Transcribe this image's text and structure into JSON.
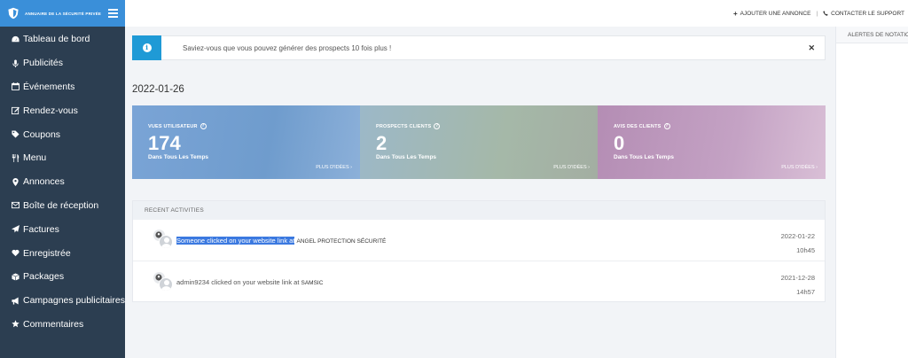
{
  "brand": {
    "name": "ANNUAIRE DE LA SÉCURITÉ PRIVÉE"
  },
  "sidebar": {
    "items": [
      {
        "label": "Tableau de bord",
        "icon": "dashboard-icon"
      },
      {
        "label": "Publicités",
        "icon": "microphone-icon"
      },
      {
        "label": "Événements",
        "icon": "calendar-icon"
      },
      {
        "label": "Rendez-vous",
        "icon": "edit-icon"
      },
      {
        "label": "Coupons",
        "icon": "tag-icon"
      },
      {
        "label": "Menu",
        "icon": "utensils-icon"
      },
      {
        "label": "Annonces",
        "icon": "map-marker-icon"
      },
      {
        "label": "Boîte de réception",
        "icon": "envelope-icon"
      },
      {
        "label": "Factures",
        "icon": "paper-plane-icon"
      },
      {
        "label": "Enregistrée",
        "icon": "heart-icon"
      },
      {
        "label": "Packages",
        "icon": "cube-icon"
      },
      {
        "label": "Campagnes publicitaires",
        "icon": "bullhorn-icon"
      },
      {
        "label": "Commentaires",
        "icon": "star-icon"
      }
    ]
  },
  "topbar": {
    "add_listing": "AJOUTER UNE ANNONCE",
    "contact_support": "CONTACTER LE SUPPORT"
  },
  "alerts_panel": {
    "title": "ALERTES DE NOTATION"
  },
  "info_alert": {
    "text": "Saviez-vous que vous pouvez générer des prospects 10 fois plus !"
  },
  "date": "2022-01-26",
  "stats": [
    {
      "label": "VUES UTILISATEUR",
      "value": "174",
      "sub": "Dans Tous Les Temps",
      "more": "PLUS D'IDÉES  ›"
    },
    {
      "label": "PROSPECTS CLIENTS",
      "value": "2",
      "sub": "Dans Tous Les Temps",
      "more": "PLUS D'IDÉES  ›"
    },
    {
      "label": "AVIS DES CLIENTS",
      "value": "0",
      "sub": "Dans Tous Les Temps",
      "more": "PLUS D'IDÉES  ›"
    }
  ],
  "activities": {
    "title": "RECENT ACTIVITIES",
    "rows": [
      {
        "actor_text": "Someone clicked on your website link at",
        "company": "ANGEL PROTECTION SÉCURITÉ",
        "date": "2022-01-22",
        "time": "10h45"
      },
      {
        "actor_text": "admin9234 clicked on your website link at",
        "company": "SAMSIC",
        "date": "2021-12-28",
        "time": "14h57"
      }
    ]
  },
  "colors": {
    "sidebar_bg": "#2c3e51",
    "brand_bg": "#3a8fd9",
    "info_blue": "#1f9ad6",
    "selection": "#3b79e0"
  }
}
